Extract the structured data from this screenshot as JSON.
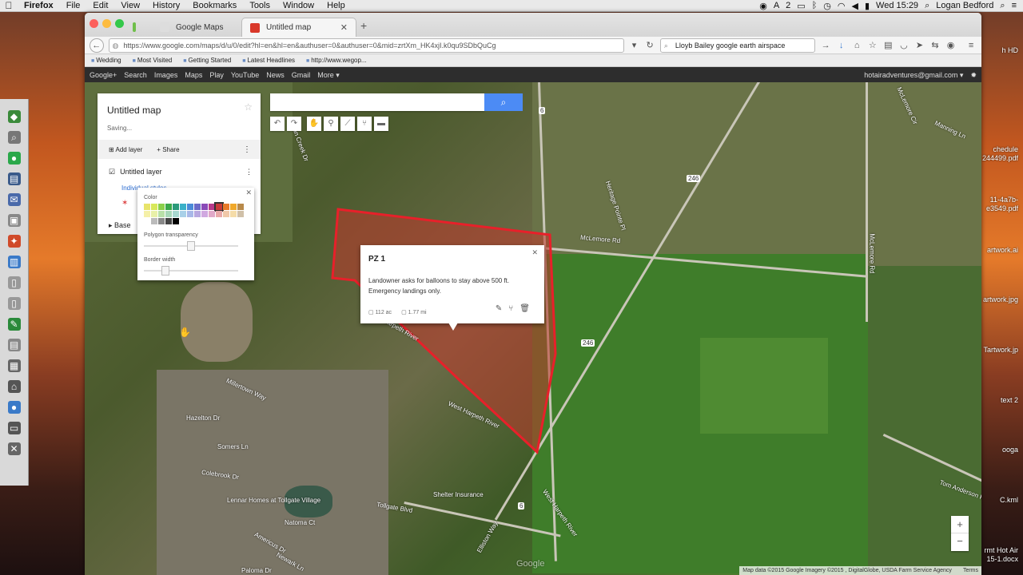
{
  "menubar": {
    "app_name": "Firefox",
    "items": [
      "File",
      "Edit",
      "View",
      "History",
      "Bookmarks",
      "Tools",
      "Window",
      "Help"
    ],
    "clock": "Wed 15:29",
    "user": "Logan Bedford",
    "badge": "2"
  },
  "tabs": [
    {
      "label": "Google Maps"
    },
    {
      "label": "Untitled map"
    }
  ],
  "navbar": {
    "url_domain": "https://www.google.com",
    "url_path": "/maps/d/u/0/edit?hl=en&hl=en&authuser=0&authuser=0&mid=zrtXm_HK4xjI.k0qu9SDbQuCg",
    "search_value": "Lloyb Bailey google earth airspace"
  },
  "bookmarks": [
    "Wedding",
    "Most Visited",
    "Getting Started",
    "Latest Headlines",
    "http://www.wegop..."
  ],
  "google_bar": {
    "links": [
      "Google+",
      "Search",
      "Images",
      "Maps",
      "Play",
      "YouTube",
      "News",
      "Gmail",
      "More"
    ],
    "account": "hotairadventures@gmail.com"
  },
  "map_panel": {
    "title": "Untitled map",
    "status": "Saving...",
    "add_layer": "Add layer",
    "share": "Share",
    "layer_name": "Untitled layer",
    "layer_item": "Individual styles",
    "base_label": "Base"
  },
  "style_popup": {
    "color_label": "Color",
    "transparency_label": "Polygon transparency",
    "border_label": "Border width",
    "transparency_value": 0.5,
    "border_value": 0.2
  },
  "info_window": {
    "title": "PZ 1",
    "description": "Landowner asks for balloons to stay above 500 ft. Emergency landings only.",
    "area": "112 ac",
    "perimeter": "1.77 mi"
  },
  "map_labels": {
    "mclemore": "McLemore Rd",
    "mclemore_v": "McLemore Rd",
    "heritage": "Heritage Pointe Pl",
    "harpeth1": "West Harpeth River",
    "harpeth2": "West Harpeth River",
    "harpeth3": "West Harpeth River",
    "millertown": "Millertown Way",
    "hazelton": "Hazelton Dr",
    "somers": "Somers Ln",
    "colebrook": "Colebrook Dr",
    "lennar": "Lennar Homes at Tollgate Village",
    "natoma": "Natoma Ct",
    "tollgate": "Tollgate Blvd",
    "shelter": "Shelter Insurance",
    "elliston": "Elliston Way",
    "americus": "Americus Dr",
    "newark": "Newark Ln",
    "paloma": "Paloma Dr",
    "tom_anderson": "Tom Anderson Rd",
    "manning": "Manning Ln",
    "mcclemore_cir": "McLemore Cir",
    "indian_creek": "Indian Creek Dr",
    "route_6a": "6",
    "route_6b": "6",
    "route_246a": "246",
    "route_246b": "246",
    "watermark": "Google"
  },
  "attribution": {
    "data": "Map data ©2015 Google Imagery ©2015 , DigitalGlobe, USDA Farm Service Agency",
    "terms": "Terms"
  },
  "desktop_files": [
    "h HD",
    "chedule",
    "244499.pdf",
    "11-4a7b-",
    "e3549.pdf",
    "artwork.ai",
    "artwork.jpg",
    "Tartwork.jp",
    "text 2",
    "ooga",
    "C.kml",
    "rmt Hot Air",
    "15-1.docx"
  ],
  "colors": {
    "polygon_fill": "#c0392b",
    "polygon_stroke": "#e8202a",
    "accent_blue": "#4c8bf5"
  }
}
